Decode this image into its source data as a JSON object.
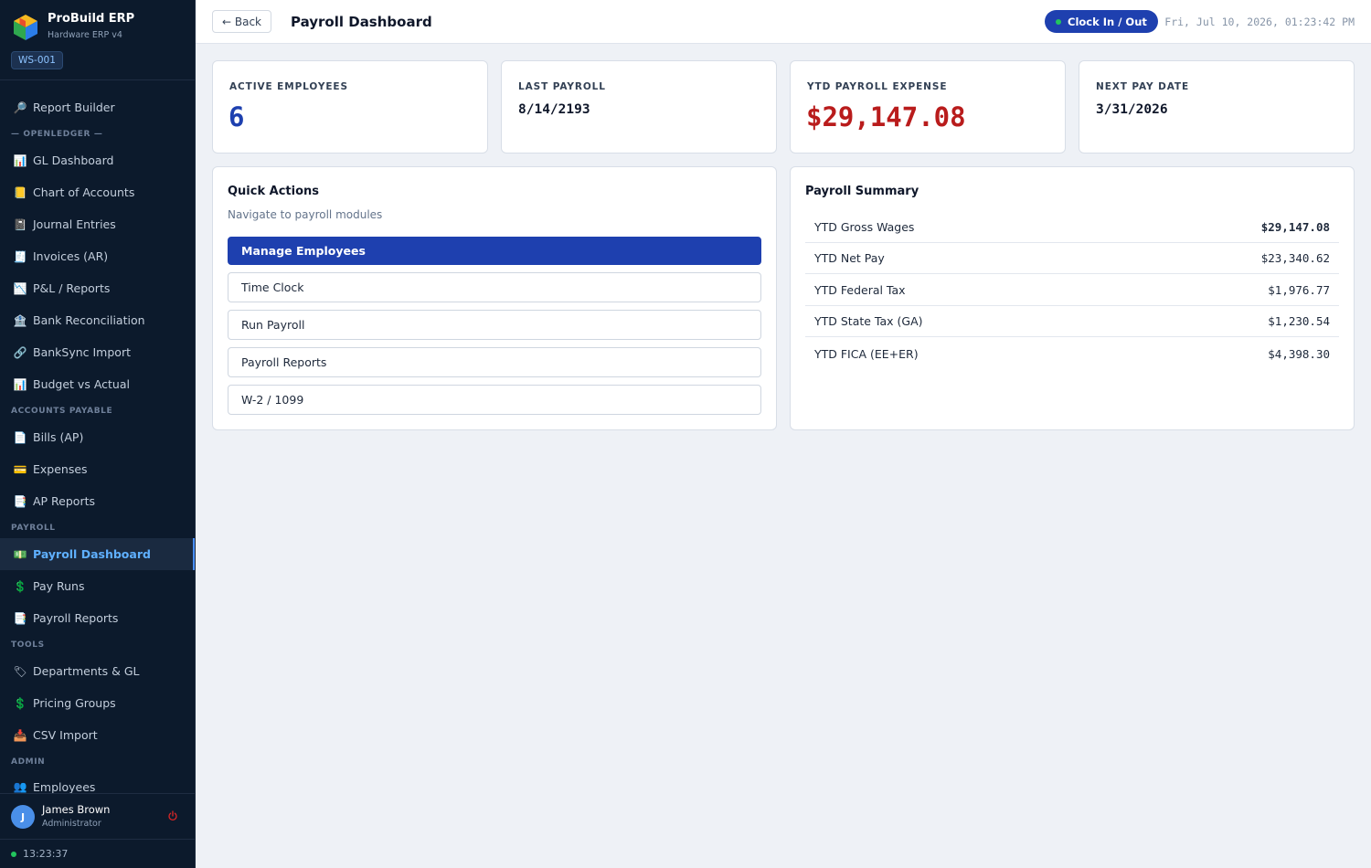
{
  "brand": {
    "title": "ProBuild ERP",
    "subtitle": "Hardware ERP v4",
    "workstation": "WS-001"
  },
  "sidebar": {
    "items": [
      {
        "type": "item",
        "label": "Report Builder",
        "icon": "magnifier-icon",
        "glyph": "🔎"
      },
      {
        "type": "section",
        "label": "— OPENLEDGER —"
      },
      {
        "type": "item",
        "label": "GL Dashboard",
        "icon": "bar-chart-icon",
        "glyph": "📊"
      },
      {
        "type": "item",
        "label": "Chart of Accounts",
        "icon": "ledger-icon",
        "glyph": "📒"
      },
      {
        "type": "item",
        "label": "Journal Entries",
        "icon": "notebook-icon",
        "glyph": "📓"
      },
      {
        "type": "item",
        "label": "Invoices (AR)",
        "icon": "receipt-icon",
        "glyph": "🧾"
      },
      {
        "type": "item",
        "label": "P&L / Reports",
        "icon": "chart-down-icon",
        "glyph": "📉"
      },
      {
        "type": "item",
        "label": "Bank Reconciliation",
        "icon": "bank-icon",
        "glyph": "🏦"
      },
      {
        "type": "item",
        "label": "BankSync Import",
        "icon": "link-icon",
        "glyph": "🔗"
      },
      {
        "type": "item",
        "label": "Budget vs Actual",
        "icon": "bar-chart-icon",
        "glyph": "📊"
      },
      {
        "type": "section",
        "label": "ACCOUNTS PAYABLE"
      },
      {
        "type": "item",
        "label": "Bills (AP)",
        "icon": "document-icon",
        "glyph": "📄"
      },
      {
        "type": "item",
        "label": "Expenses",
        "icon": "credit-card-icon",
        "glyph": "💳"
      },
      {
        "type": "item",
        "label": "AP Reports",
        "icon": "report-icon",
        "glyph": "📑"
      },
      {
        "type": "section",
        "label": "PAYROLL"
      },
      {
        "type": "item",
        "label": "Payroll Dashboard",
        "icon": "money-icon",
        "glyph": "💵",
        "active": true
      },
      {
        "type": "item",
        "label": "Pay Runs",
        "icon": "dollar-icon",
        "glyph": "💲"
      },
      {
        "type": "item",
        "label": "Payroll Reports",
        "icon": "report-icon",
        "glyph": "📑"
      },
      {
        "type": "section",
        "label": "TOOLS"
      },
      {
        "type": "item",
        "label": "Departments & GL",
        "icon": "tag-icon",
        "glyph": "🏷"
      },
      {
        "type": "item",
        "label": "Pricing Groups",
        "icon": "dollar-icon",
        "glyph": "💲"
      },
      {
        "type": "item",
        "label": "CSV Import",
        "icon": "inbox-icon",
        "glyph": "📥"
      },
      {
        "type": "section",
        "label": "ADMIN"
      },
      {
        "type": "item",
        "label": "Employees",
        "icon": "people-icon",
        "glyph": "👥",
        "partial": true
      }
    ]
  },
  "user": {
    "initial": "J",
    "name": "James Brown",
    "role": "Administrator"
  },
  "status_clock": "13:23:37",
  "header": {
    "back_label": "← Back",
    "title": "Payroll Dashboard",
    "clock_button": "Clock In / Out",
    "datetime": "Fri, Jul 10, 2026, 01:23:42 PM"
  },
  "stats": {
    "active_employees": {
      "label": "ACTIVE EMPLOYEES",
      "value": "6",
      "color": "#1e40af"
    },
    "last_payroll": {
      "label": "LAST PAYROLL",
      "value": "8/14/2193"
    },
    "ytd_expense": {
      "label": "YTD PAYROLL EXPENSE",
      "value": "$29,147.08",
      "color": "#b91c1c"
    },
    "next_pay_date": {
      "label": "NEXT PAY DATE",
      "value": "3/31/2026"
    }
  },
  "quick_actions": {
    "title": "Quick Actions",
    "subtitle": "Navigate to payroll modules",
    "buttons": [
      "Manage Employees",
      "Time Clock",
      "Run Payroll",
      "Payroll Reports",
      "W-2 / 1099"
    ]
  },
  "summary": {
    "title": "Payroll Summary",
    "rows": [
      {
        "label": "YTD Gross Wages",
        "value": "$29,147.08"
      },
      {
        "label": "YTD Net Pay",
        "value": "$23,340.62"
      },
      {
        "label": "YTD Federal Tax",
        "value": "$1,976.77"
      },
      {
        "label": "YTD State Tax (GA)",
        "value": "$1,230.54"
      },
      {
        "label": "YTD FICA (EE+ER)",
        "value": "$4,398.30"
      }
    ]
  }
}
